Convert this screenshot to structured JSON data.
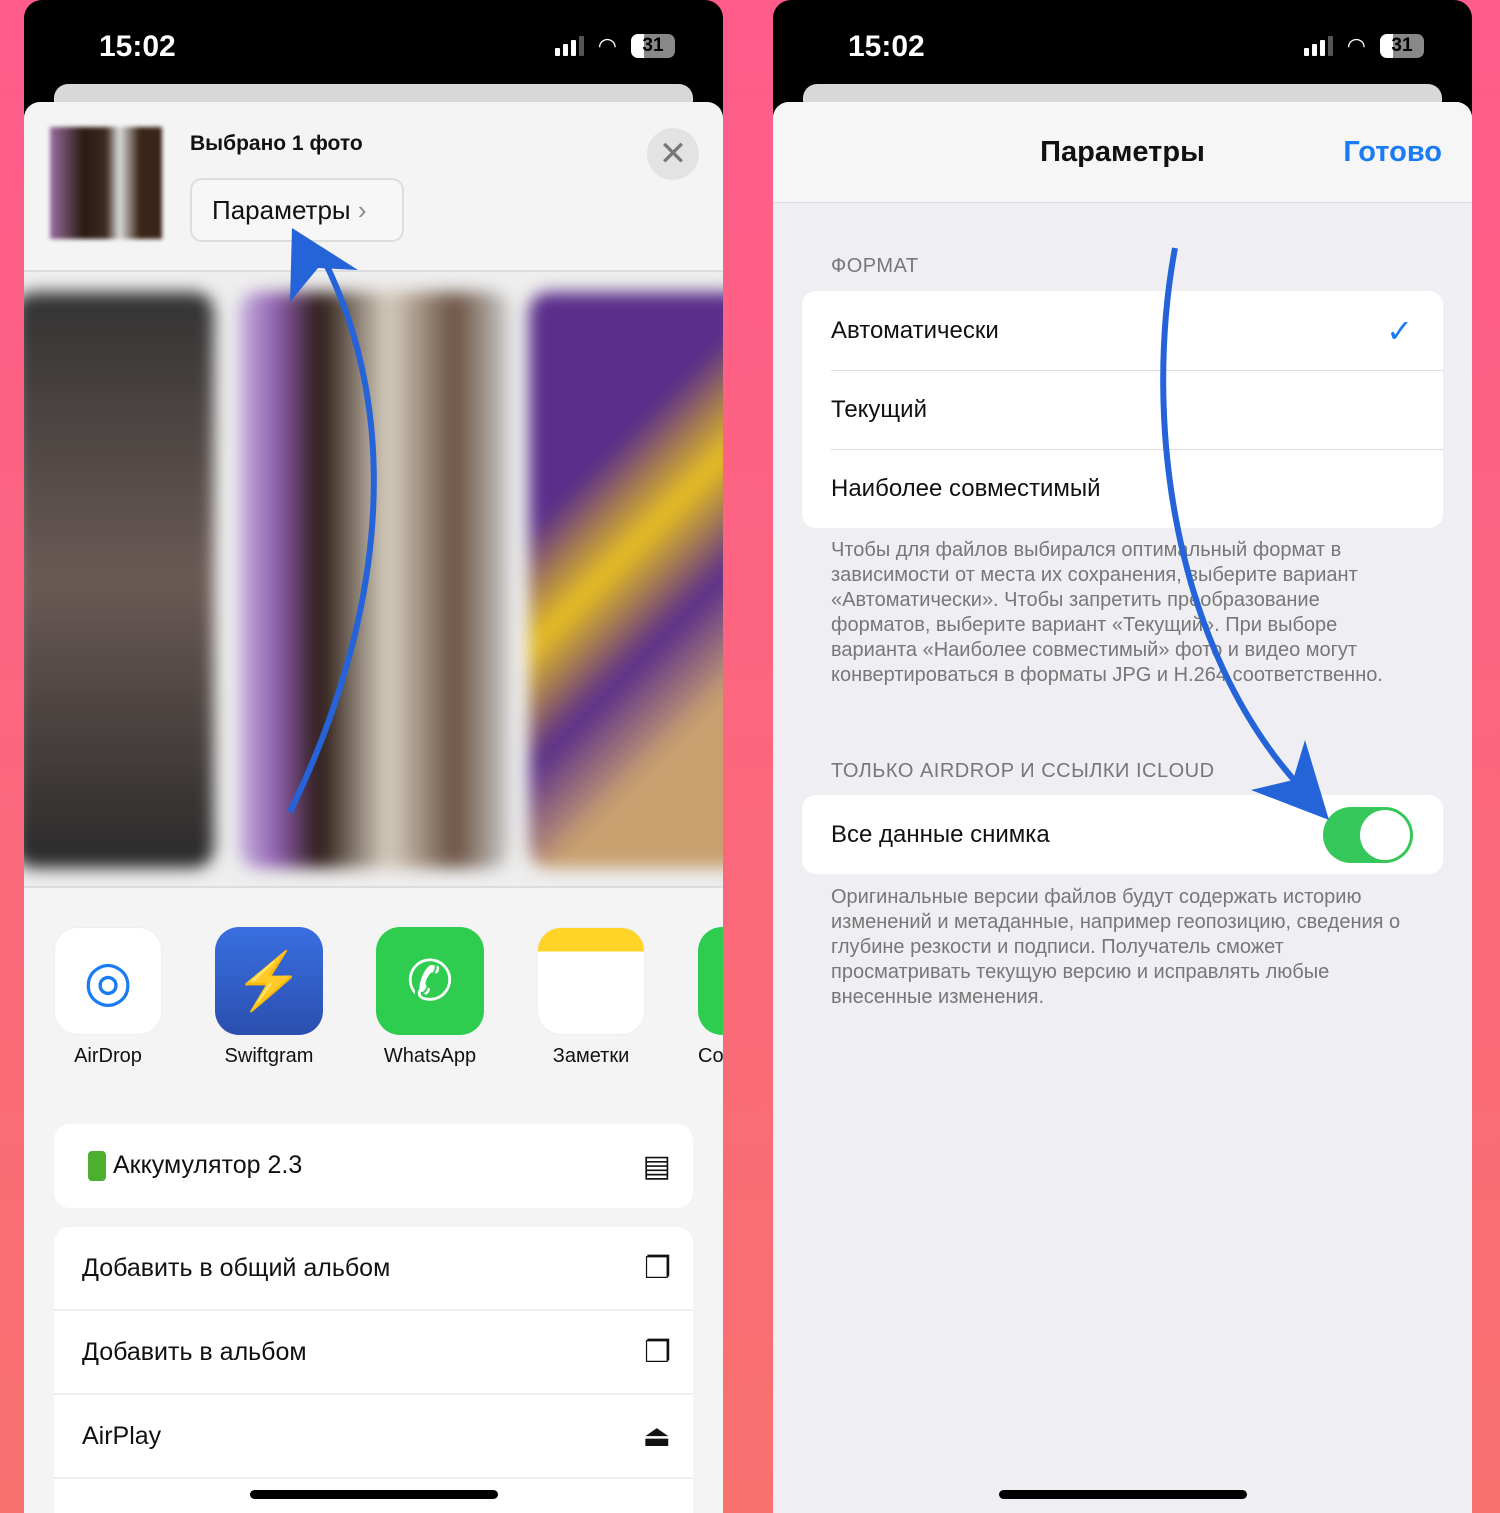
{
  "left": {
    "status": {
      "time": "15:02",
      "battery": "31"
    },
    "header": {
      "selected": "Выбрано 1 фото",
      "options_label": "Параметры",
      "chevron": "›",
      "close": "✕"
    },
    "apps": [
      {
        "label": "AirDrop",
        "icon": "airdrop-icon",
        "color": "#ffffff"
      },
      {
        "label": "Swiftgram",
        "icon": "swiftgram-icon",
        "color": "#2c5fd0"
      },
      {
        "label": "WhatsApp",
        "icon": "whatsapp-icon",
        "color": "#2ecc4f"
      },
      {
        "label": "Заметки",
        "icon": "notes-icon",
        "color": "#ffffff"
      },
      {
        "label": "Coo",
        "icon": "partial-app-icon",
        "color": "#2ecc4f"
      }
    ],
    "shortcut": {
      "label": "Аккумулятор 2.3"
    },
    "actions": [
      {
        "label": "Добавить в общий альбом",
        "icon": "shared-album-icon"
      },
      {
        "label": "Добавить в альбом",
        "icon": "add-album-icon"
      },
      {
        "label": "AirPlay",
        "icon": "airplay-icon"
      },
      {
        "label": "",
        "icon": "partial-icon"
      }
    ]
  },
  "right": {
    "status": {
      "time": "15:02",
      "battery": "31"
    },
    "nav": {
      "title": "Параметры",
      "done": "Готово"
    },
    "format": {
      "header": "ФОРМАТ",
      "options": [
        {
          "label": "Автоматически",
          "selected": true
        },
        {
          "label": "Текущий",
          "selected": false
        },
        {
          "label": "Наиболее совместимый",
          "selected": false
        }
      ],
      "footer": "Чтобы для файлов выбирался оптимальный формат в зависимости от места их сохранения, выберите вариант «Автоматически». Чтобы запретить преобразование форматов, выберите вариант «Текущий». При выборе варианта «Наиболее совместимый» фото и видео могут конвертироваться в форматы JPG и H.264 соответственно."
    },
    "airdrop": {
      "header": "ТОЛЬКО AIRDROP И ССЫЛКИ ICLOUD",
      "toggle_label": "Все данные снимка",
      "toggle_on": true,
      "footer": "Оригинальные версии файлов будут содержать историю изменений и метаданные, например геопозицию, сведения о глубине резкости и подписи. Получатель сможет просматривать текущую версию и исправлять любые внесенные изменения."
    },
    "colors": {
      "accent": "#1a7cf5",
      "toggle": "#35c759",
      "annotation_arrow": "#2563d9"
    }
  }
}
